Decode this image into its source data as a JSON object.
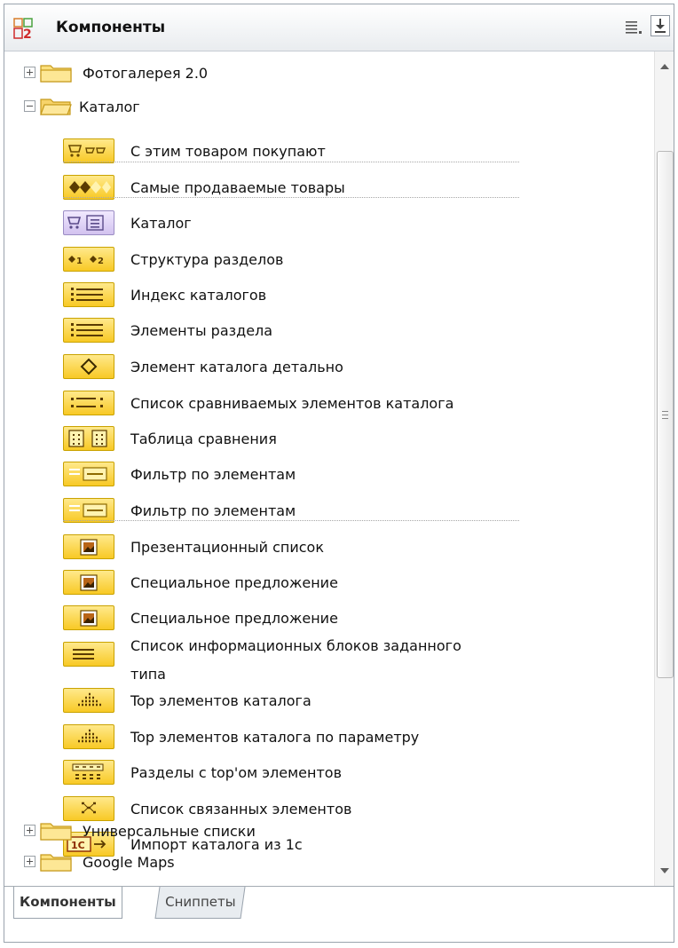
{
  "panel": {
    "title": "Компоненты",
    "icons": {
      "logo": "bitrix-2-logo-icon",
      "menu": "list-menu-icon",
      "download": "download-icon"
    }
  },
  "tree": {
    "groups": [
      {
        "label": "Фотогалерея 2.0",
        "expanded": false
      },
      {
        "label": "Каталог",
        "expanded": true,
        "items": [
          {
            "label": "С этим товаром покупают",
            "icon": "cart-with-products-icon"
          },
          {
            "label": "Самые продаваемые товары",
            "icon": "diamonds-icon"
          },
          {
            "label": "Каталог",
            "icon": "catalog-cart-list-icon"
          },
          {
            "label": "Структура разделов",
            "icon": "numbered-sections-icon"
          },
          {
            "label": "Индекс каталогов",
            "icon": "list-icon"
          },
          {
            "label": "Элементы раздела",
            "icon": "list-icon"
          },
          {
            "label": "Элемент каталога детально",
            "icon": "diamond-outline-icon"
          },
          {
            "label": "Список сравниваемых элементов каталога",
            "icon": "compare-list-icon"
          },
          {
            "label": "Таблица сравнения",
            "icon": "compare-table-icon"
          },
          {
            "label": "Фильтр по элементам",
            "icon": "filter-icon"
          },
          {
            "label": "Фильтр по элементам",
            "icon": "filter-icon"
          },
          {
            "label": "Презентационный список",
            "icon": "picture-icon"
          },
          {
            "label": "Специальное предложение",
            "icon": "picture-icon"
          },
          {
            "label": "Специальное предложение",
            "icon": "picture-icon"
          },
          {
            "label": "Список информационных блоков заданного",
            "label2": "типа",
            "icon": "lines-icon"
          },
          {
            "label": "Top элементов каталога",
            "icon": "top-pyramid-icon"
          },
          {
            "label": "Top элементов каталога по параметру",
            "icon": "top-pyramid-icon"
          },
          {
            "label": "Разделы с top'ом элементов",
            "icon": "sections-top-icon"
          },
          {
            "label": "Список связанных элементов",
            "icon": "linked-elements-icon"
          },
          {
            "label": "Импорт каталога из 1с",
            "icon": "import-1c-icon",
            "icon_text": "1C"
          }
        ]
      },
      {
        "label": "Универсальные списки",
        "expanded": false
      },
      {
        "label": "Google Maps",
        "expanded": false
      }
    ]
  },
  "tabs": [
    {
      "label": "Компоненты",
      "active": true
    },
    {
      "label": "Сниппеты",
      "active": false
    }
  ]
}
